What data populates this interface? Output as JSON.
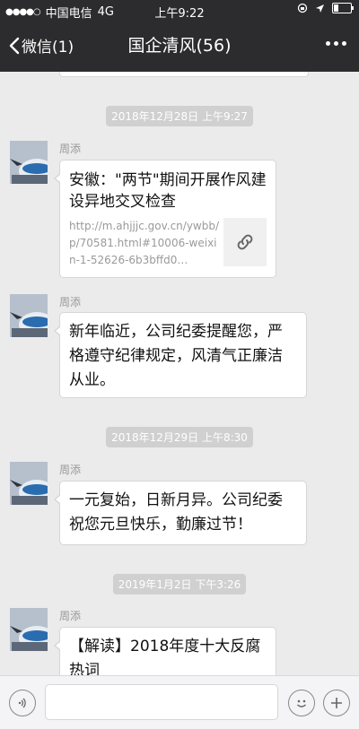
{
  "status_bar": {
    "carrier": "中国电信",
    "network": "4G",
    "time": "上午9:22"
  },
  "nav": {
    "back_label": "微信(1)",
    "title": "国企清风(56)"
  },
  "messages": [
    {
      "timestamp": "2018年12月28日 上午9:27",
      "sender": "周添",
      "type": "link",
      "link_title": "安徽：\"两节\"期间开展作风建设异地交叉检查",
      "link_desc": "http://m.ahjjjc.gov.cn/ywbb/p/70581.html#10006-weixin-1-52626-6b3bffd0…"
    },
    {
      "sender": "周添",
      "type": "text",
      "text": "新年临近，公司纪委提醒您，严格遵守纪律规定，风清气正廉洁从业。"
    },
    {
      "timestamp": "2018年12月29日 上午8:30",
      "sender": "周添",
      "type": "text",
      "text": "一元复始，日新月异。公司纪委祝您元旦快乐，勤廉过节！"
    },
    {
      "timestamp": "2019年1月2日 下午3:26",
      "sender": "周添",
      "type": "text",
      "text": "【解读】2018年度十大反腐热词"
    }
  ],
  "colors": {
    "nav_bg": "#2c2c2e",
    "chat_bg": "#ebebeb",
    "bubble_bg": "#ffffff",
    "timestamp_bg": "#d0d0d0"
  },
  "icons": {
    "back": "chevron-left-icon",
    "more": "more-dots-icon",
    "link": "link-icon",
    "voice": "voice-icon",
    "emoji": "emoji-icon",
    "add": "plus-icon"
  }
}
